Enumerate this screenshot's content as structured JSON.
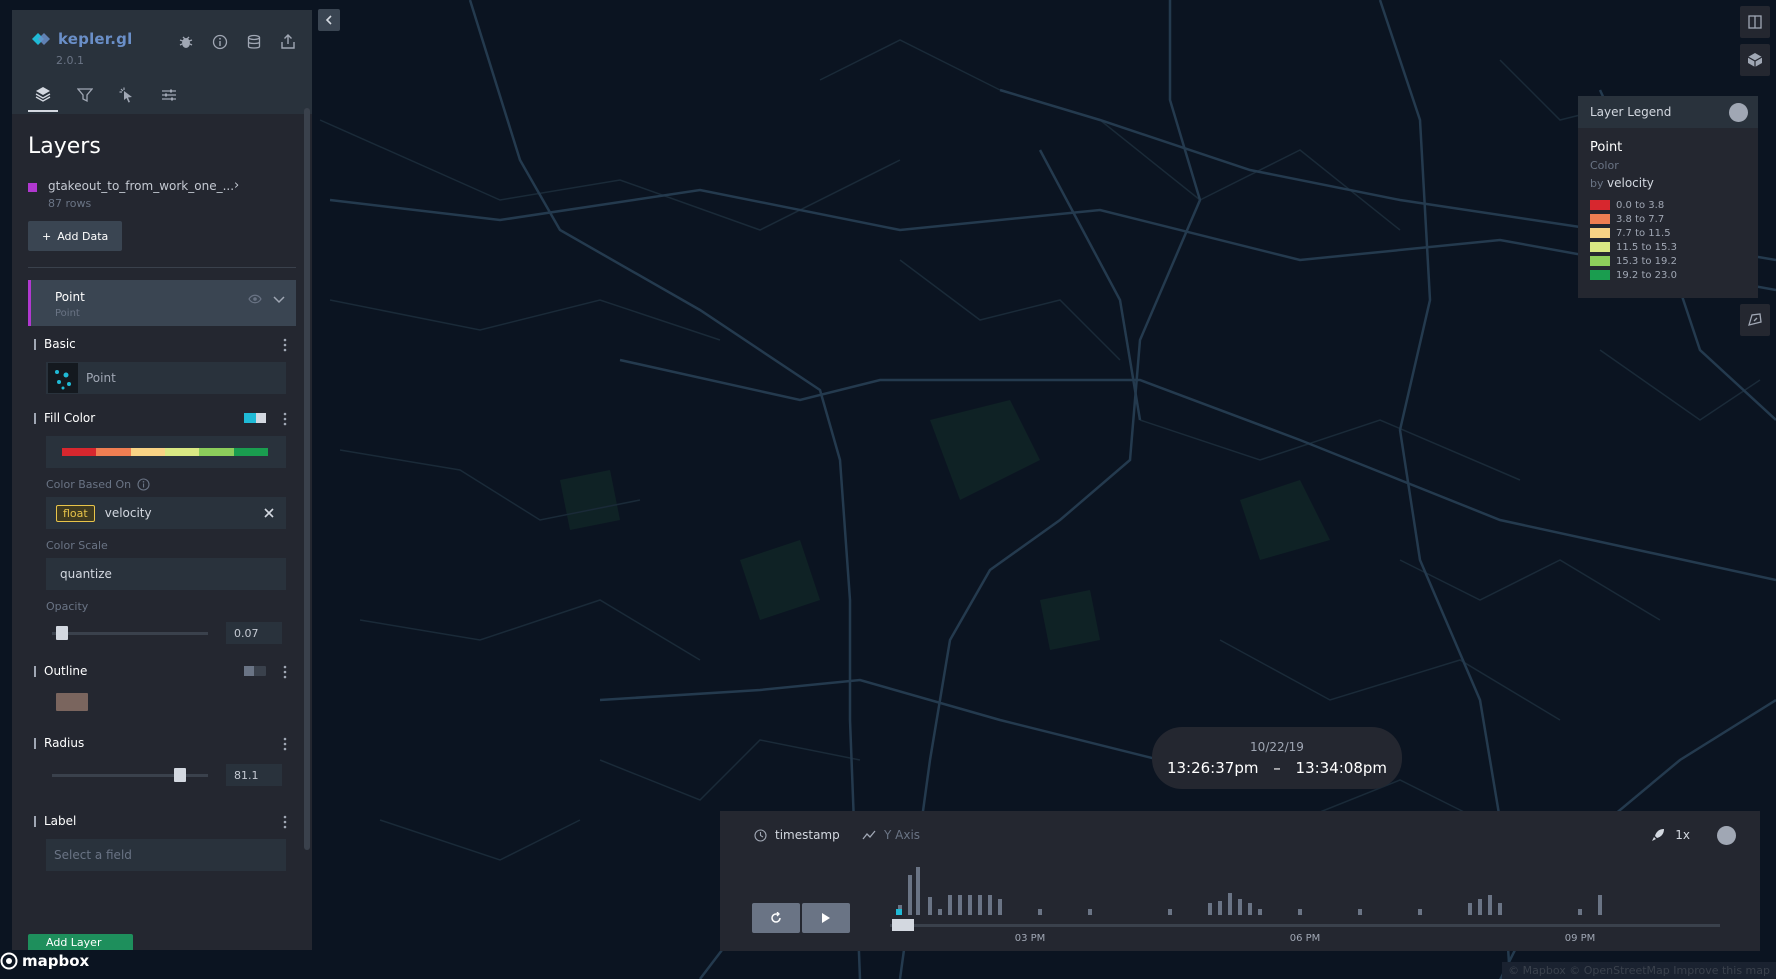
{
  "app": {
    "name": "kepler.gl",
    "version": "2.0.1"
  },
  "side": {
    "title": "Layers",
    "dataset": {
      "name": "gtakeout_to_from_work_one_...",
      "rows": "87 rows"
    },
    "add_data": "Add Data",
    "layer": {
      "title": "Point",
      "type": "Point"
    },
    "basic": {
      "title": "Basic",
      "type_value": "Point"
    },
    "fill": {
      "title": "Fill Color",
      "ramp_colors": [
        "#d7272e",
        "#ef7e52",
        "#f8d385",
        "#d9e883",
        "#8ccd5b",
        "#1a9d4f"
      ],
      "based_on_label": "Color Based On",
      "field_type": "float",
      "field": "velocity",
      "scale_label": "Color Scale",
      "scale": "quantize",
      "opacity_label": "Opacity",
      "opacity": "0.07"
    },
    "outline": {
      "title": "Outline",
      "color": "#7a655e"
    },
    "radius": {
      "title": "Radius",
      "value": "81.1"
    },
    "label": {
      "title": "Label",
      "placeholder": "Select a field"
    },
    "add_layer": "Add Layer"
  },
  "legend": {
    "title": "Layer Legend",
    "layer": "Point",
    "channel": "Color",
    "by_prefix": "by ",
    "by_field": "velocity",
    "items": [
      {
        "color": "#d7272e",
        "label": "0.0 to 3.8"
      },
      {
        "color": "#ef7e52",
        "label": "3.8 to 7.7"
      },
      {
        "color": "#f8d385",
        "label": "7.7 to 11.5"
      },
      {
        "color": "#d9e883",
        "label": "11.5 to 15.3"
      },
      {
        "color": "#8ccd5b",
        "label": "15.3 to 19.2"
      },
      {
        "color": "#1a9d4f",
        "label": "19.2 to 23.0"
      }
    ]
  },
  "time": {
    "date": "10/22/19",
    "start": "13:26:37pm",
    "dash": "–",
    "end": "13:34:08pm"
  },
  "timeline": {
    "field": "timestamp",
    "y_axis": "Y Axis",
    "speed": "1x",
    "ticks": [
      "03 PM",
      "06 PM",
      "09 PM"
    ]
  },
  "footer": {
    "brand": "mapbox",
    "attribution": "© Mapbox © OpenStreetMap  Improve this map"
  }
}
